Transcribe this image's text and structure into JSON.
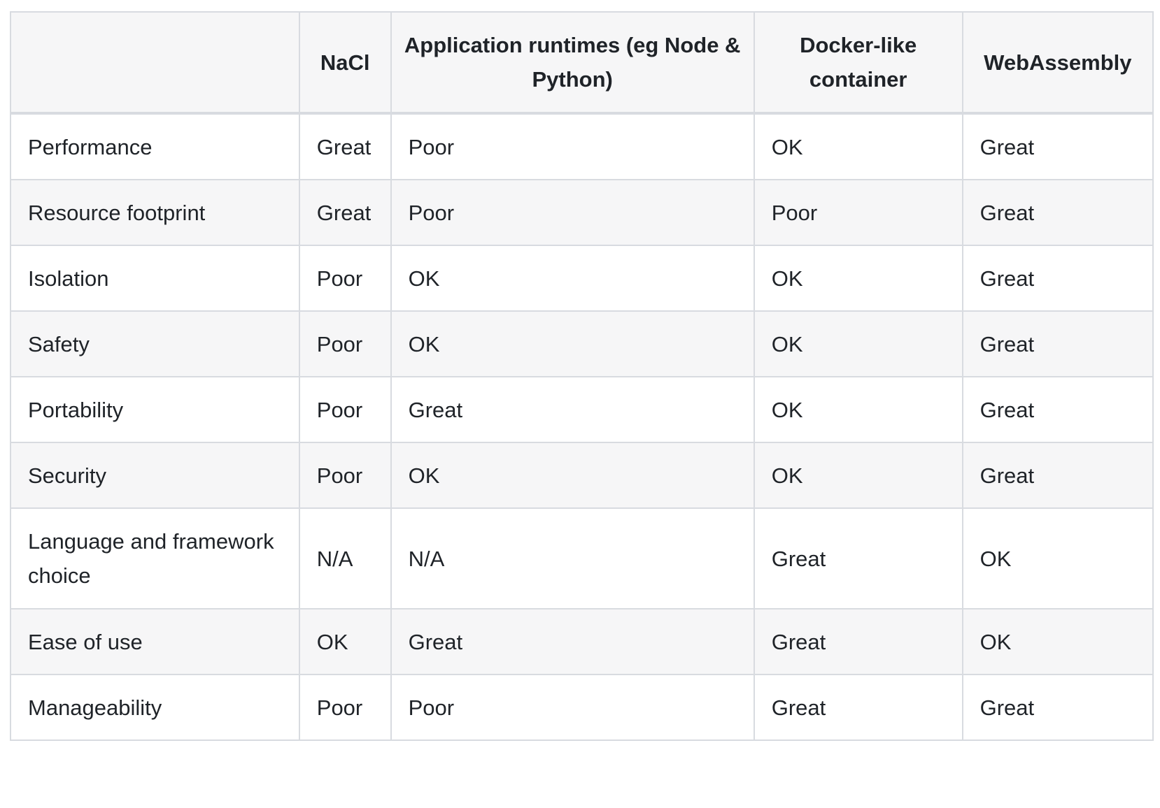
{
  "table": {
    "headers": [
      "",
      "NaCl",
      "Application runtimes (eg Node & Python)",
      "Docker-like container",
      "WebAssembly"
    ],
    "rows": [
      [
        "Performance",
        "Great",
        "Poor",
        "OK",
        "Great"
      ],
      [
        "Resource footprint",
        "Great",
        "Poor",
        "Poor",
        "Great"
      ],
      [
        "Isolation",
        "Poor",
        "OK",
        "OK",
        "Great"
      ],
      [
        "Safety",
        "Poor",
        "OK",
        "OK",
        "Great"
      ],
      [
        "Portability",
        "Poor",
        "Great",
        "OK",
        "Great"
      ],
      [
        "Security",
        "Poor",
        "OK",
        "OK",
        "Great"
      ],
      [
        "Language and framework choice",
        "N/A",
        "N/A",
        "Great",
        "OK"
      ],
      [
        "Ease of use",
        "OK",
        "Great",
        "Great",
        "OK"
      ],
      [
        "Manageability",
        "Poor",
        "Poor",
        "Great",
        "Great"
      ]
    ]
  }
}
